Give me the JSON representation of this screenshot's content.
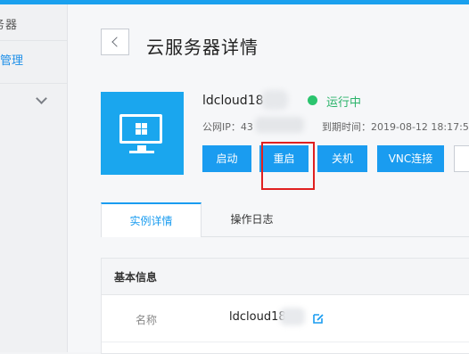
{
  "sidebar": {
    "header": "务器",
    "active_item": "管理"
  },
  "header": {
    "title": "云服务器详情"
  },
  "instance": {
    "name": "ldcloud18",
    "status": "运行中",
    "ip_label": "公网IP：43",
    "expire_label": "到期时间：2019-08-12 18:17:5",
    "status_color": "#2bc46e"
  },
  "actions": {
    "start": "启动",
    "restart": "重启",
    "shutdown": "关机",
    "vnc": "VNC连接"
  },
  "tabs": [
    {
      "label": "实例详情"
    },
    {
      "label": "操作日志"
    }
  ],
  "basic_info": {
    "title": "基本信息",
    "rows": [
      {
        "label": "名称",
        "value": "ldcloud18"
      }
    ]
  },
  "colors": {
    "accent": "#1a9cf0",
    "highlight": "#e02020"
  },
  "icons": {
    "back": "chevron-left-icon",
    "expand": "chevron-down-icon",
    "os": "windows-monitor-icon",
    "edit": "edit-icon"
  }
}
